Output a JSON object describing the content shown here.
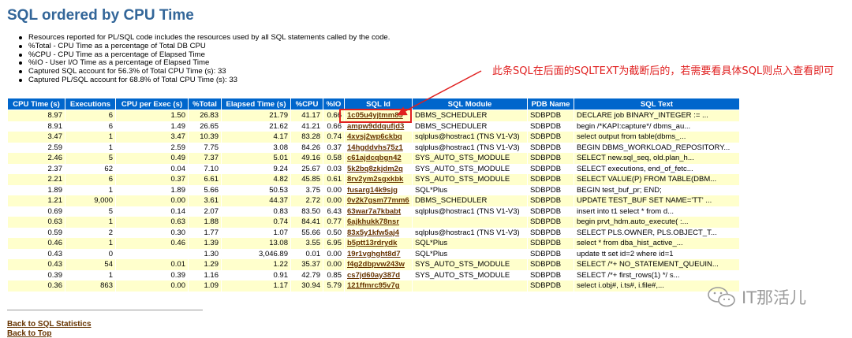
{
  "page": {
    "title": "SQL ordered by CPU Time"
  },
  "notes": [
    "Resources reported for PL/SQL code includes the resources used by all SQL statements called by the code.",
    "%Total - CPU Time as a percentage of Total DB CPU",
    "%CPU - CPU Time as a percentage of Elapsed Time",
    "%IO - User I/O Time as a percentage of Elapsed Time",
    "Captured SQL account for 56.3% of Total CPU Time (s): 33",
    "Captured PL/SQL account for 68.8% of Total CPU Time (s): 33"
  ],
  "table": {
    "headers": [
      "CPU Time (s)",
      "Executions",
      "CPU per Exec (s)",
      "%Total",
      "Elapsed Time (s)",
      "%CPU",
      "%IO",
      "SQL Id",
      "SQL Module",
      "PDB Name",
      "SQL Text"
    ],
    "rows": [
      [
        "8.97",
        "6",
        "1.50",
        "26.83",
        "21.79",
        "41.17",
        "0.66",
        "1c05u4yjtmm89",
        "DBMS_SCHEDULER",
        "SDBPDB",
        "DECLARE job BINARY_INTEGER := ..."
      ],
      [
        "8.91",
        "6",
        "1.49",
        "26.65",
        "21.62",
        "41.21",
        "0.66",
        "ampw9ddqufjd3",
        "DBMS_SCHEDULER",
        "SDBPDB",
        "begin /*KAPI:capture*/ dbms_au..."
      ],
      [
        "3.47",
        "1",
        "3.47",
        "10.39",
        "4.17",
        "83.28",
        "0.74",
        "4xvsj2wp6ckbq",
        "sqlplus@hostrac1 (TNS V1-V3)",
        "SDBPDB",
        "select output from table(dbms_..."
      ],
      [
        "2.59",
        "1",
        "2.59",
        "7.75",
        "3.08",
        "84.26",
        "0.37",
        "14hgddvhs75z1",
        "sqlplus@hostrac1 (TNS V1-V3)",
        "SDBPDB",
        "BEGIN DBMS_WORKLOAD_REPOSITORY..."
      ],
      [
        "2.46",
        "5",
        "0.49",
        "7.37",
        "5.01",
        "49.16",
        "0.58",
        "c61ajdcqbgn42",
        "SYS_AUTO_STS_MODULE",
        "SDBPDB",
        "SELECT new.sql_seq, old.plan_h..."
      ],
      [
        "2.37",
        "62",
        "0.04",
        "7.10",
        "9.24",
        "25.67",
        "0.03",
        "5k2bq8zkjdm2q",
        "SYS_AUTO_STS_MODULE",
        "SDBPDB",
        "SELECT executions, end_of_fetc..."
      ],
      [
        "2.21",
        "6",
        "0.37",
        "6.61",
        "4.82",
        "45.85",
        "0.61",
        "8rv2ym2sgxkbk",
        "SYS_AUTO_STS_MODULE",
        "SDBPDB",
        "SELECT VALUE(P) FROM TABLE(DBM..."
      ],
      [
        "1.89",
        "1",
        "1.89",
        "5.66",
        "50.53",
        "3.75",
        "0.00",
        "fusarg14k9sjg",
        "SQL*Plus",
        "SDBPDB",
        "BEGIN test_buf_pr; END;"
      ],
      [
        "1.21",
        "9,000",
        "0.00",
        "3.61",
        "44.37",
        "2.72",
        "0.00",
        "0v2k7gsm77mm6",
        "DBMS_SCHEDULER",
        "SDBPDB",
        "UPDATE TEST_BUF SET NAME='TT' ..."
      ],
      [
        "0.69",
        "5",
        "0.14",
        "2.07",
        "0.83",
        "83.50",
        "6.43",
        "63war7a7kbabt",
        "sqlplus@hostrac1 (TNS V1-V3)",
        "SDBPDB",
        "insert into t1 select * from d..."
      ],
      [
        "0.63",
        "1",
        "0.63",
        "1.88",
        "0.74",
        "84.41",
        "0.77",
        "6ajkhukk78nsr",
        "",
        "SDBPDB",
        "begin prvt_hdm.auto_execute( :..."
      ],
      [
        "0.59",
        "2",
        "0.30",
        "1.77",
        "1.07",
        "55.66",
        "0.50",
        "83x5y1kfw5aj4",
        "sqlplus@hostrac1 (TNS V1-V3)",
        "SDBPDB",
        "SELECT PLS.OWNER, PLS.OBJECT_T..."
      ],
      [
        "0.46",
        "1",
        "0.46",
        "1.39",
        "13.08",
        "3.55",
        "6.95",
        "b5ptt13rdrydk",
        "SQL*Plus",
        "SDBPDB",
        "select * from dba_hist_active_..."
      ],
      [
        "0.43",
        "0",
        "",
        "1.30",
        "3,046.89",
        "0.01",
        "0.00",
        "19r1vghght8d7",
        "SQL*Plus",
        "SDBPDB",
        "update tt set id=2 where id=1"
      ],
      [
        "0.43",
        "54",
        "0.01",
        "1.29",
        "1.22",
        "35.37",
        "0.00",
        "f4g2dbpvw243w",
        "SYS_AUTO_STS_MODULE",
        "SDBPDB",
        "SELECT /*+ NO_STATEMENT_QUEUIN..."
      ],
      [
        "0.39",
        "1",
        "0.39",
        "1.16",
        "0.91",
        "42.79",
        "0.85",
        "cs7jd60ay387d",
        "SYS_AUTO_STS_MODULE",
        "SDBPDB",
        "SELECT /*+ first_rows(1) */ s..."
      ],
      [
        "0.36",
        "863",
        "0.00",
        "1.09",
        "1.17",
        "30.94",
        "5.79",
        "121ffmrc95v7g",
        "",
        "SDBPDB",
        "select i.obj#, i.ts#, i.file#,..."
      ]
    ]
  },
  "links": {
    "back_sql_stats": "Back to SQL Statistics",
    "back_top": "Back to Top"
  },
  "annotation": {
    "text": "此条SQL在后面的SQLTEXT为截断后的，若需要看具体SQL则点入查看即可",
    "color": "#e02020"
  },
  "watermark": {
    "text": "IT那活儿"
  },
  "colors": {
    "title": "#336699",
    "header_bg": "#0066cc",
    "row_odd": "#ffffcc",
    "link": "#663300"
  }
}
